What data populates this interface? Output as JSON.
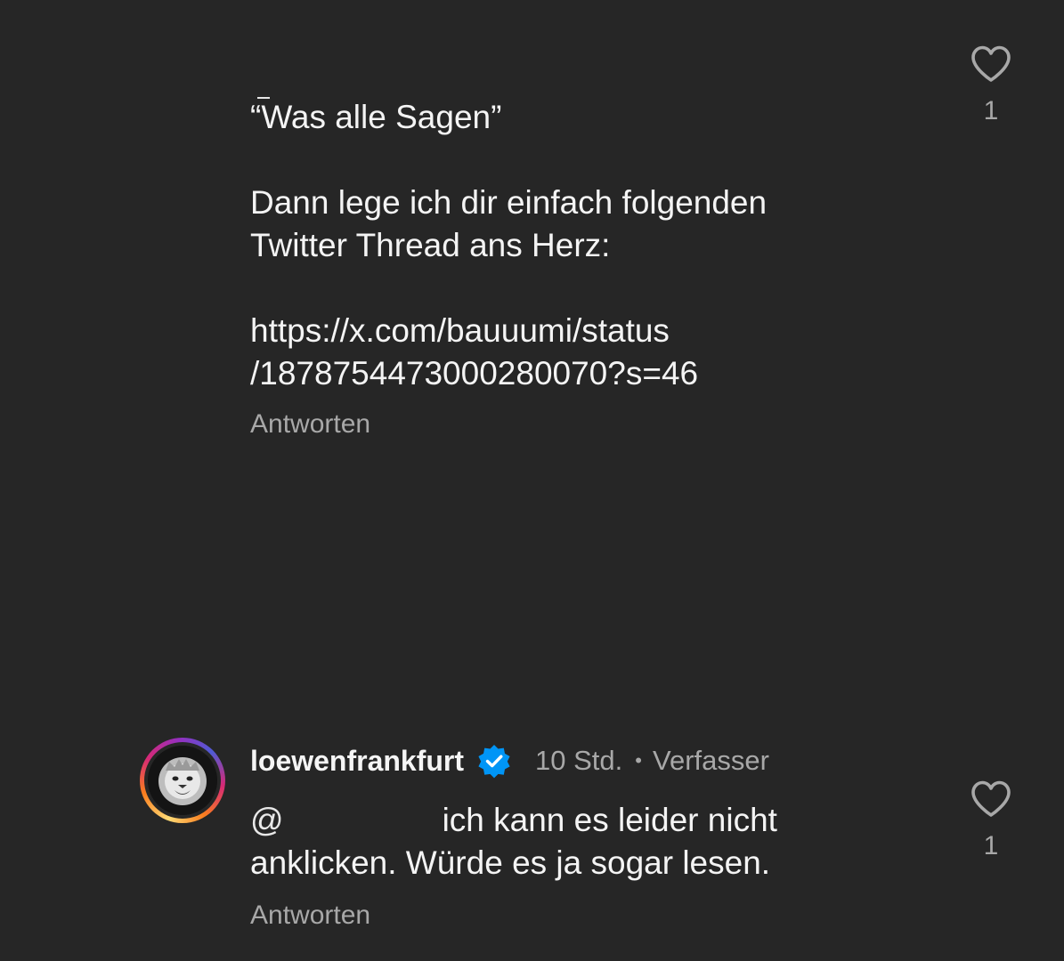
{
  "comment_1": {
    "lines": [
      "“Was alle Sagen”",
      "",
      "Dann lege ich dir einfach folgenden",
      "Twitter Thread ans Herz:",
      "",
      "https://x.com/bauuumi/status",
      "/1878754473000280070?s=46"
    ],
    "reply_label": "Antworten",
    "like_count": "1"
  },
  "comment_2": {
    "username": "loewenfrankfurt",
    "time": "10 Std.",
    "separator": "•",
    "author_badge": "Verfasser",
    "mention_prefix": "@",
    "text_line_1": "ich kann es leider nicht",
    "text_line_2": "anklicken. Würde es ja sogar lesen.",
    "reply_label": "Antworten",
    "like_count": "1"
  },
  "icons": {
    "like": "heart-outline-icon",
    "verified": "verified-badge-icon"
  },
  "colors": {
    "background": "#262626",
    "text": "#f5f5f5",
    "muted": "#a8a8a8",
    "verified_blue": "#0095f6"
  }
}
